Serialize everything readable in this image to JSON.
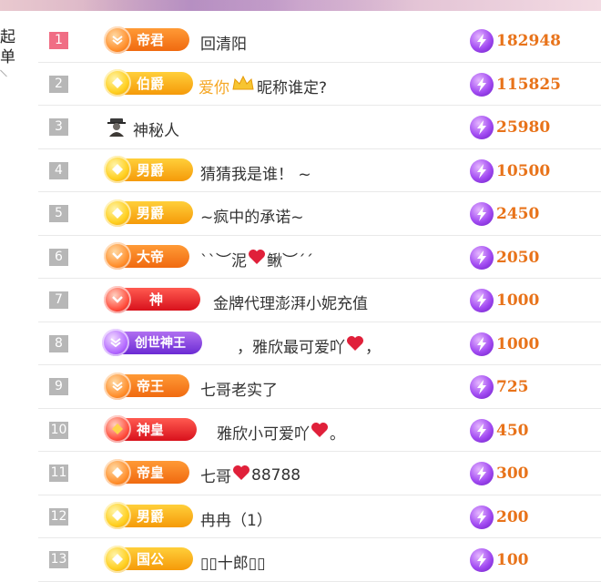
{
  "side_tab": {
    "label": "起单"
  },
  "colors": {
    "value_text": "#e8731a",
    "rank_first": "#f06d84",
    "rank_default": "#b7b7b7",
    "name_accent": "#f5a623"
  },
  "rows": [
    {
      "rank": "1",
      "badge": "帝君",
      "badge_style": "orange",
      "name": "回清阳",
      "value": "182948"
    },
    {
      "rank": "2",
      "badge": "伯爵",
      "badge_style": "gold",
      "name_accent": "爱你",
      "name_rest": "昵称谁定?",
      "icon": "crown-icon",
      "value": "115825"
    },
    {
      "rank": "3",
      "badge": "",
      "badge_style": "none",
      "name": "神秘人",
      "icon": "mystery-user-icon",
      "value": "25980"
    },
    {
      "rank": "4",
      "badge": "男爵",
      "badge_style": "gold",
      "name": "猜猜我是谁！ ~",
      "value": "10500"
    },
    {
      "rank": "5",
      "badge": "男爵",
      "badge_style": "gold",
      "name": "~疯中的承诺~",
      "value": "2450"
    },
    {
      "rank": "6",
      "badge": "大帝",
      "badge_style": "orange",
      "name_pre": "ˋˋ︶泥",
      "name_post": "鳅︶ˊˊ",
      "icon": "heart-icon",
      "value": "2050"
    },
    {
      "rank": "7",
      "badge": "神",
      "badge_style": "red",
      "name": "金牌代理澎湃小妮充值",
      "value": "1000"
    },
    {
      "rank": "8",
      "badge": "创世神王",
      "badge_style": "purple",
      "name_pre": "，雅欣最可爱吖",
      "name_post": "，",
      "icon": "heart-icon",
      "value": "1000"
    },
    {
      "rank": "9",
      "badge": "帝王",
      "badge_style": "orange",
      "name": "七哥老实了",
      "value": "725"
    },
    {
      "rank": "10",
      "badge": "神皇",
      "badge_style": "red",
      "name_pre": "雅欣小可爱吖",
      "name_post": "。",
      "icon": "heart-icon",
      "value": "450"
    },
    {
      "rank": "11",
      "badge": "帝皇",
      "badge_style": "orange",
      "name_pre": "七哥",
      "name_post": "88788",
      "icon": "heart-icon",
      "value": "300"
    },
    {
      "rank": "12",
      "badge": "男爵",
      "badge_style": "gold",
      "name": "冉冉（1）",
      "value": "200"
    },
    {
      "rank": "13",
      "badge": "国公",
      "badge_style": "gold",
      "name": "▯▯十郎▯▯",
      "value": "100"
    }
  ]
}
